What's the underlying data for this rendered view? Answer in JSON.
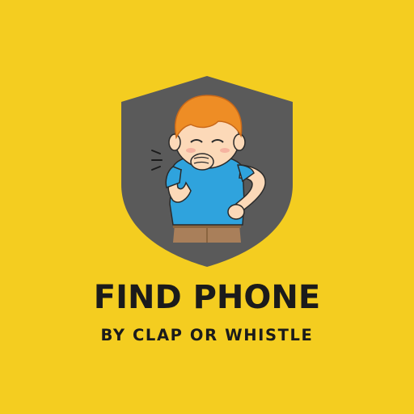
{
  "app": {
    "title": "FIND PHONE",
    "subtitle": "BY CLAP OR WHISTLE"
  },
  "colors": {
    "background": "#F4CD20",
    "shield": "#5A5A5A",
    "text": "#1B1B1B",
    "shirt": "#2FA3DD",
    "hair": "#EE8D25",
    "skin": "#FCD9B8",
    "pants": "#A97F5A"
  },
  "icons": {
    "emblem": "shield-icon",
    "mascot": "whistling-boy-icon"
  }
}
